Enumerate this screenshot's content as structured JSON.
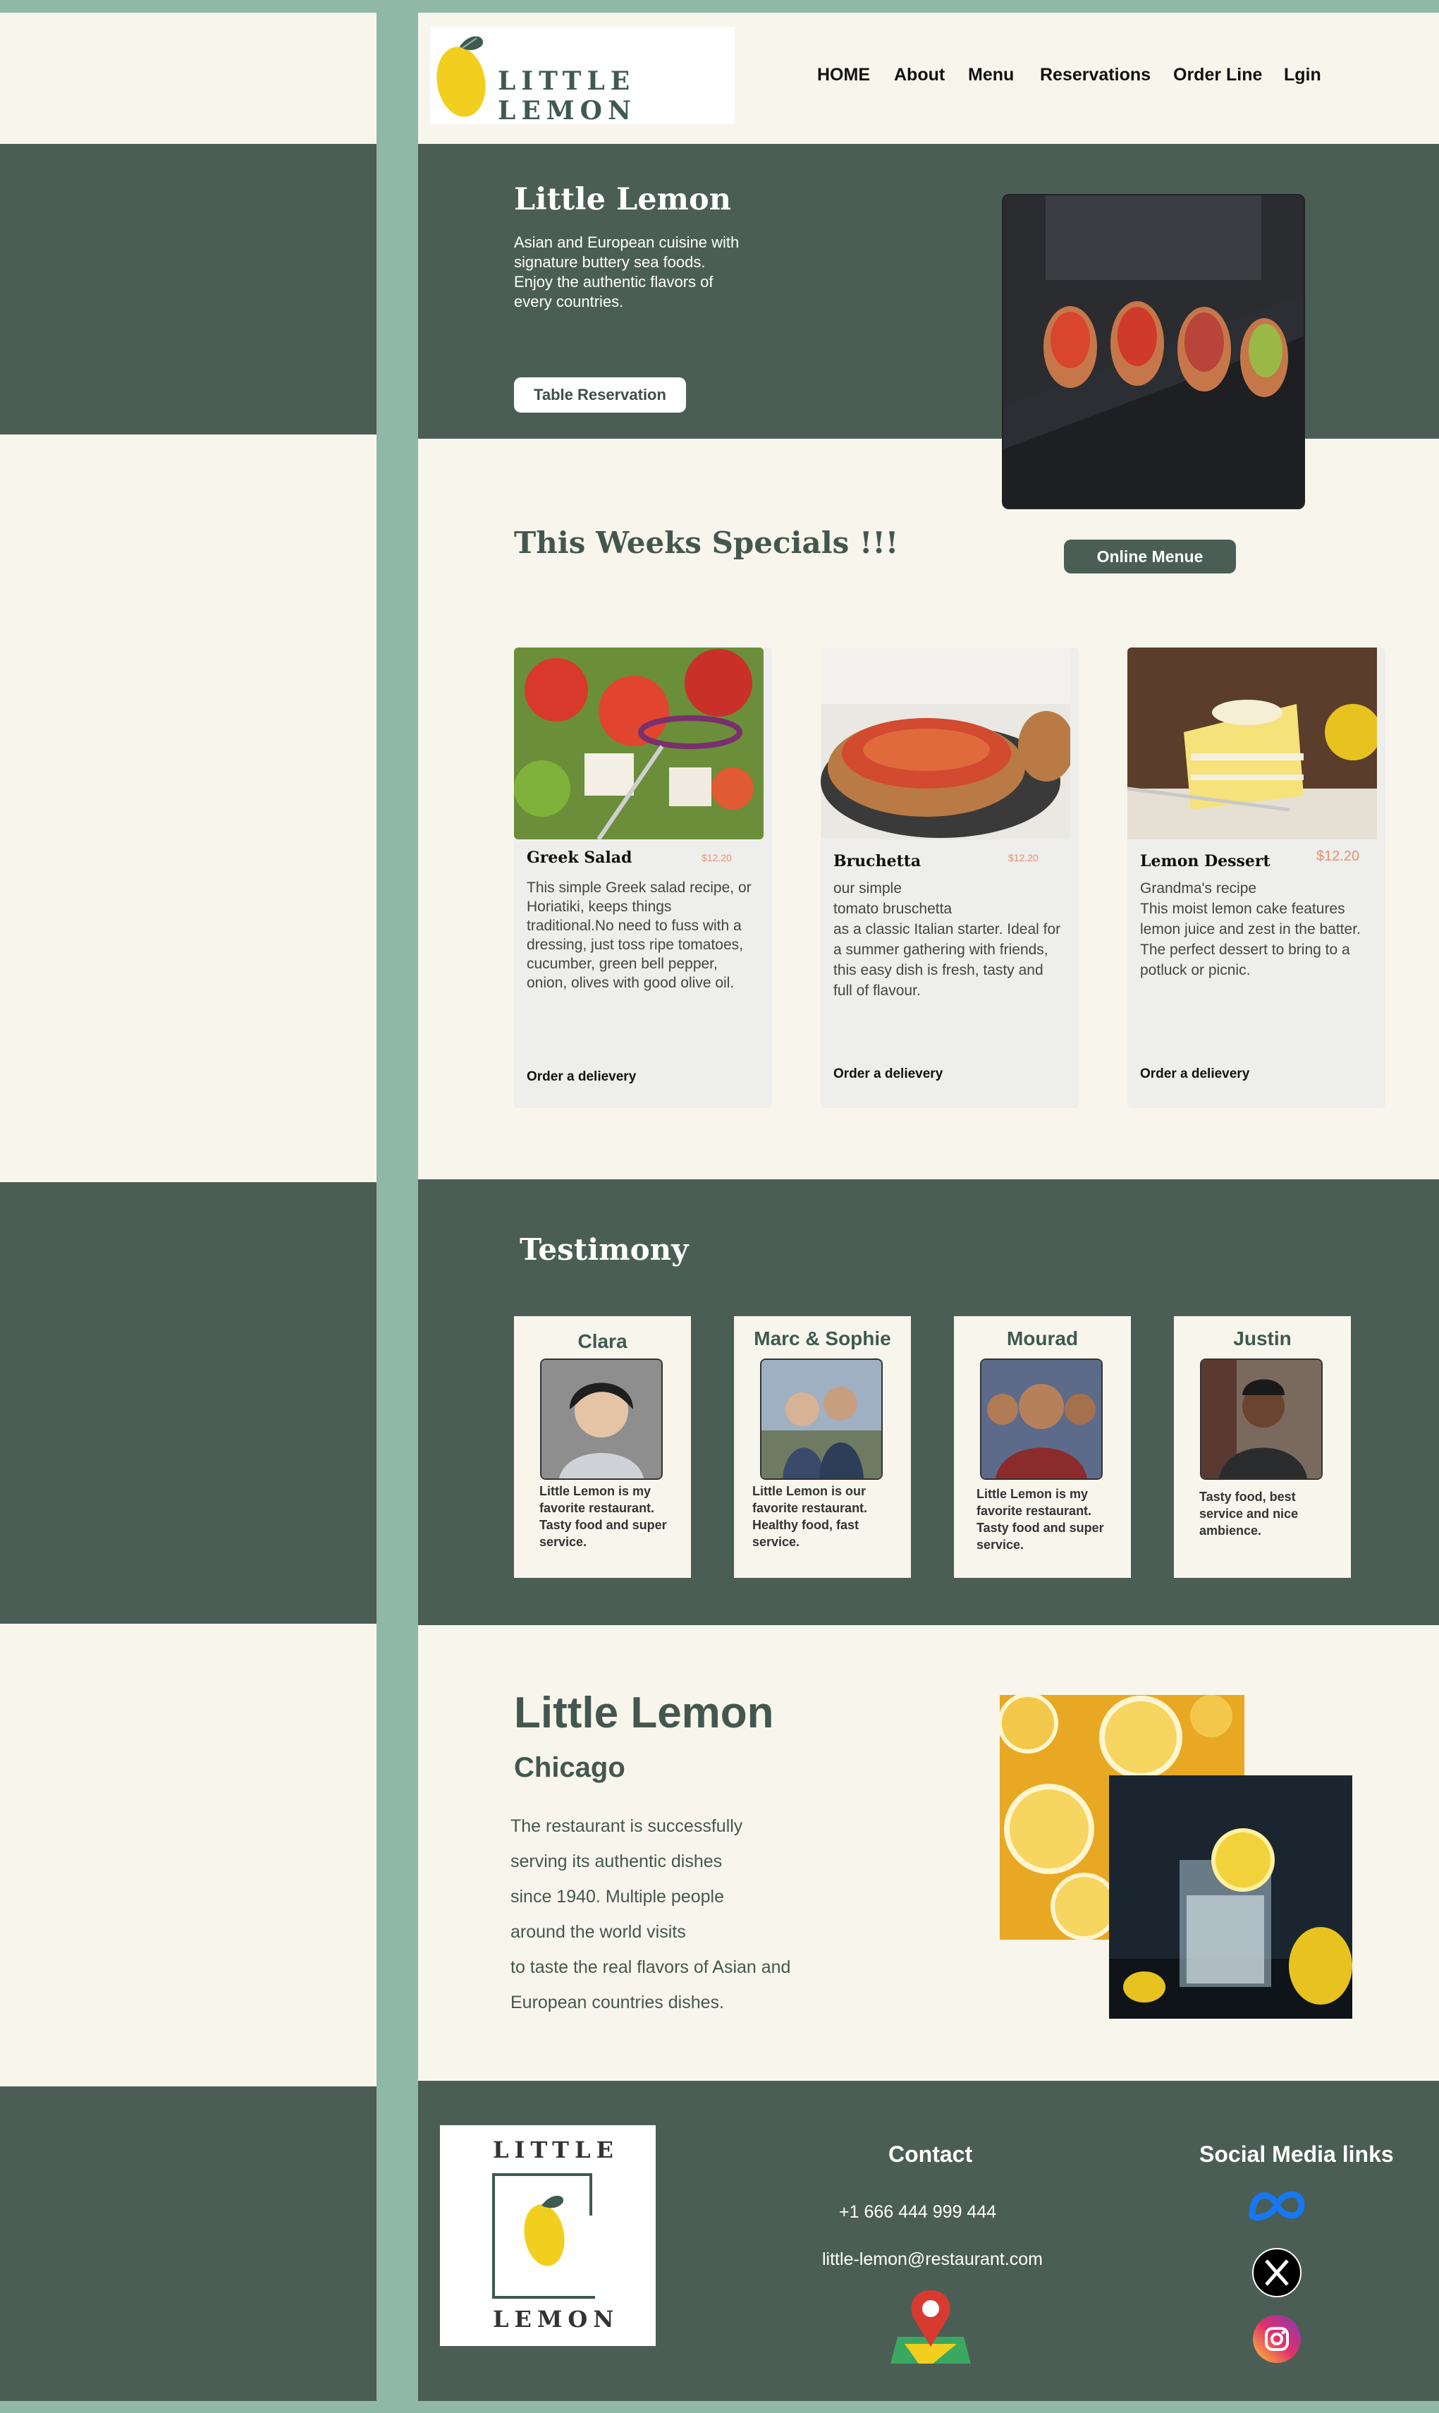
{
  "brand": {
    "name": "LITTLE LEMON",
    "logo_top": "LITTLE",
    "logo_bottom": "LEMON"
  },
  "nav": [
    {
      "label": "HOME"
    },
    {
      "label": "About"
    },
    {
      "label": "Menu"
    },
    {
      "label": "Reservations"
    },
    {
      "label": "Order Line"
    },
    {
      "label": "Lgin"
    }
  ],
  "hero": {
    "title": "Little Lemon",
    "description": "Asian and European cuisine with signature buttery sea foods.\nEnjoy the authentic flavors of every countries.",
    "button": "Table Reservation"
  },
  "specials": {
    "title": "This Weeks Specials !!!",
    "button": "Online Menue",
    "cards": [
      {
        "title": "Greek Salad",
        "price": "$12.20",
        "description": "This simple Greek salad recipe, or Horiatiki, keeps things traditional.No need to fuss with a dressing, just toss ripe tomatoes, cucumber, green bell pepper, onion, olives with good olive oil.",
        "order": "Order a delievery"
      },
      {
        "title": "Bruchetta",
        "price": "$12.20",
        "description": "our simple\ntomato bruschetta\nas a classic Italian starter. Ideal for a summer gathering with friends, this easy dish is fresh, tasty and full of flavour.",
        "order": "Order a delievery"
      },
      {
        "title": "Lemon Dessert",
        "price": "$12.20",
        "description": "Grandma's recipe\nThis moist lemon cake features lemon juice and zest in the batter.\nThe perfect dessert to bring to a potluck or picnic.",
        "order": "Order a delievery"
      }
    ]
  },
  "testimony": {
    "title": "Testimony",
    "items": [
      {
        "name": "Clara",
        "quote": "Little Lemon is my favorite restaurant. Tasty food and super service."
      },
      {
        "name": "Marc & Sophie",
        "quote": "Little Lemon is our favorite restaurant. Healthy food, fast service."
      },
      {
        "name": "Mourad",
        "quote": "Little Lemon is my favorite restaurant. Tasty food and super service."
      },
      {
        "name": "Justin",
        "quote": "Tasty food, best service and nice ambience."
      }
    ]
  },
  "about": {
    "title": "Little Lemon",
    "city": "Chicago",
    "lines": [
      "The restaurant is successfully",
      "serving its authentic dishes",
      "since 1940. Multiple people",
      "around the world visits",
      "to taste the real flavors of Asian and",
      "European countries dishes."
    ]
  },
  "footer": {
    "contact_title": "Contact",
    "phone": "+1 666 444 999 444",
    "email": "little-lemon@restaurant.com",
    "social_title": "Social Media links",
    "icons": [
      "meta-icon",
      "x-icon",
      "instagram-icon",
      "map-pin-icon"
    ]
  },
  "colors": {
    "dark_green": "#4a5e55",
    "cream": "#f8f6ec",
    "frame_green": "#8fb8a8",
    "price_accent": "#e89070"
  }
}
